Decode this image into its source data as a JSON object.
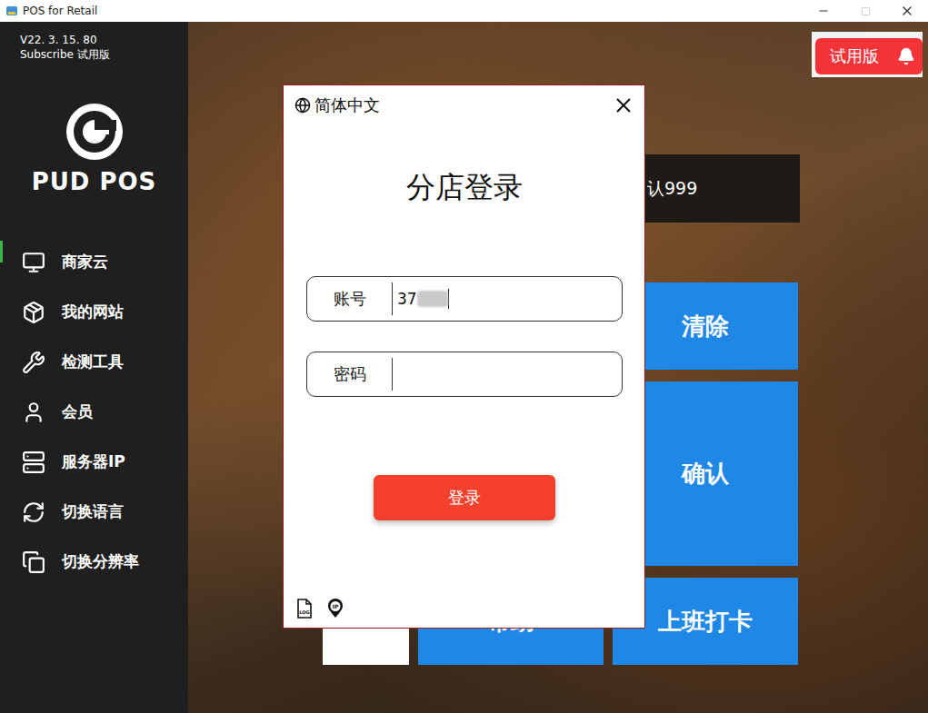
{
  "window": {
    "title": "POS for Retail"
  },
  "sidebar": {
    "version": "V22. 3. 15. 80",
    "subscription": "Subscribe 试用版",
    "logo_text": "PUD POS",
    "items": [
      {
        "label": "商家云",
        "selected": true
      },
      {
        "label": "我的网站",
        "selected": false
      },
      {
        "label": "检测工具",
        "selected": false
      },
      {
        "label": "会员",
        "selected": false
      },
      {
        "label": "服务器IP",
        "selected": false
      },
      {
        "label": "切换语言",
        "selected": false
      },
      {
        "label": "切换分辨率",
        "selected": false
      }
    ]
  },
  "badge": {
    "label": "试用版"
  },
  "keypad": {
    "display": "认999",
    "clear_key": "清除",
    "confirm_key": "确认",
    "bottom_keys": [
      {
        "kind": "blank",
        "label": ""
      },
      {
        "kind": "action",
        "label": "帮助"
      },
      {
        "kind": "action",
        "label": "上班打卡"
      }
    ]
  },
  "dialog": {
    "language": "简体中文",
    "title": "分店登录",
    "fields": [
      {
        "label": "账号",
        "value": "37",
        "redacted": true
      },
      {
        "label": "密码",
        "value": "",
        "redacted": false
      }
    ],
    "submit": "登录",
    "footer_icons": [
      "LOG",
      "IP"
    ]
  }
}
